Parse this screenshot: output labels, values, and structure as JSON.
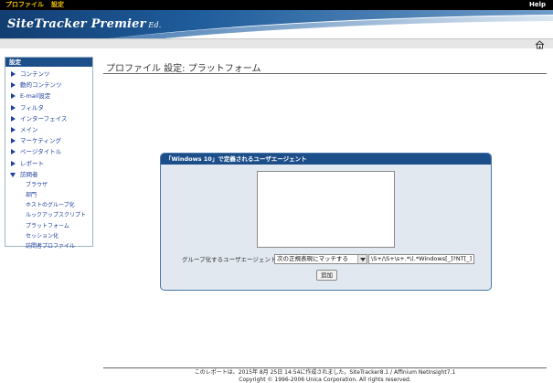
{
  "topbar": {
    "menu_profile": "プロファイル",
    "menu_settings": "設定",
    "help": "Help"
  },
  "banner": {
    "brand_main": "SiteTracker Premier",
    "brand_ed": " Ed."
  },
  "sidebar": {
    "header": "設定",
    "items": [
      {
        "label": "コンテンツ"
      },
      {
        "label": "動的コンテンツ"
      },
      {
        "label": "E-mail設定"
      },
      {
        "label": "フィルタ"
      },
      {
        "label": "インターフェイス"
      },
      {
        "label": "メイン"
      },
      {
        "label": "マーケティング"
      },
      {
        "label": "ページタイトル"
      },
      {
        "label": "レポート"
      },
      {
        "label": "訪問者"
      }
    ],
    "subitems": [
      {
        "label": "ブラウザ"
      },
      {
        "label": "部門"
      },
      {
        "label": "ホストのグループ化"
      },
      {
        "label": "ルックアップスクリプト"
      },
      {
        "label": "プラットフォーム"
      },
      {
        "label": "セッション化"
      },
      {
        "label": "訪問者プロファイル"
      }
    ]
  },
  "page": {
    "title_prefix": "プロファイル 設定:",
    "title_suffix": " プラットフォーム"
  },
  "panel": {
    "header": "「Windows 10」で定義されるユーザエージェント",
    "group_label": "グループ化するユーザエージェント",
    "match_selected": "次の正規表現にマッチする",
    "regex_value": "\\S+/\\S+\\s+.*\\(.*Windows[_]?NT[_]",
    "add_button": "追加"
  },
  "footer": {
    "line1": "このレポートは、2015年 8月 25日 14:54に作成されました。SiteTracker8.1 / Affinium NetInsight7.1",
    "line2": "Copyright © 1996-2006 Unica Corporation. All rights reserved."
  },
  "colors": {
    "accent_blue": "#1c4f8a",
    "menu_yellow": "#f2c200",
    "link_blue": "#1d3f9e",
    "panel_bg": "#e1e8ef"
  }
}
